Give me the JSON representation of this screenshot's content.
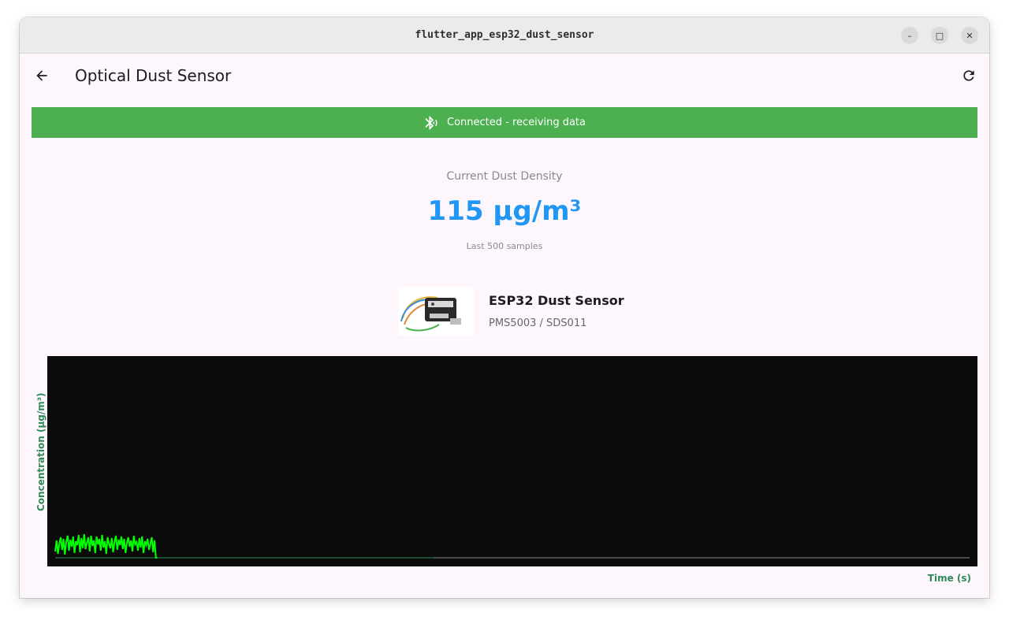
{
  "window": {
    "title": "flutter_app_esp32_dust_sensor",
    "controls": {
      "minimize": "–",
      "maximize": "□",
      "close": "✕"
    }
  },
  "appbar": {
    "title": "Optical Dust Sensor",
    "back_icon": "arrow-back-icon",
    "refresh_icon": "refresh-icon"
  },
  "status": {
    "text": "Connected - receiving data",
    "icon": "bluetooth-searching-icon",
    "color": "#4caf50"
  },
  "reading": {
    "label": "Current Dust Density",
    "value": "115 µg/m³",
    "subtitle": "Last 500 samples",
    "color": "#2196f3"
  },
  "device": {
    "name": "ESP32 Dust Sensor",
    "model": "PMS5003 / SDS011"
  },
  "chart": {
    "ylabel": "Concentration (µg/m³)",
    "xlabel": "Time (s)",
    "line_color": "#00ff00",
    "background": "#0b0b0b"
  },
  "chart_data": {
    "type": "line",
    "xlabel": "Time (s)",
    "ylabel": "Concentration (µg/m³)",
    "grid": false,
    "series": [
      {
        "values": [
          8,
          22,
          5,
          18,
          26,
          10,
          24,
          4,
          20,
          28,
          9,
          23,
          14,
          27,
          6,
          21,
          16,
          29,
          7,
          25,
          12,
          30,
          11,
          19,
          26,
          8,
          28,
          15,
          22,
          6,
          27,
          17,
          24,
          9,
          29,
          13,
          21,
          5,
          26,
          18,
          12,
          25,
          7,
          20,
          28,
          10,
          23,
          16,
          27,
          11,
          24,
          6,
          19,
          26,
          14,
          22,
          8,
          28,
          17,
          20,
          9,
          25,
          13,
          27,
          6,
          21,
          16,
          24,
          10,
          18,
          26,
          7,
          22,
          0,
          0
        ]
      }
    ]
  }
}
